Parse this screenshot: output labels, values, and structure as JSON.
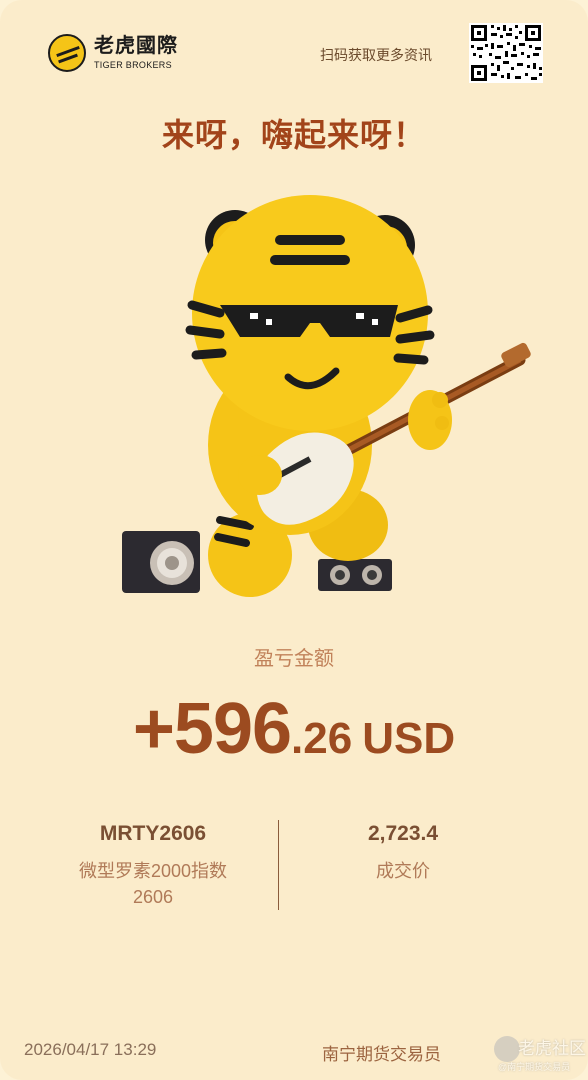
{
  "brand": {
    "name_cn": "老虎國際",
    "name_en": "TIGER BROKERS"
  },
  "header": {
    "scan_text": "扫码获取更多资讯"
  },
  "slogan": "来呀，嗨起来呀！",
  "pnl": {
    "label": "盈亏金额",
    "integer": "+596",
    "decimal": ".26",
    "currency": "USD"
  },
  "contract": {
    "code": "MRTY2606",
    "name": "微型罗素2000指数2606"
  },
  "price": {
    "value": "2,723.4",
    "label": "成交价"
  },
  "footer": {
    "datetime": "2026/04/17 13:29",
    "role": "南宁期货交易员"
  },
  "watermark": {
    "text": "老虎社区",
    "sub": "@南宁期货交易员"
  },
  "colors": {
    "background": "#fbeccb",
    "accent": "#9c4b20",
    "tiger_yellow": "#f5c417"
  }
}
